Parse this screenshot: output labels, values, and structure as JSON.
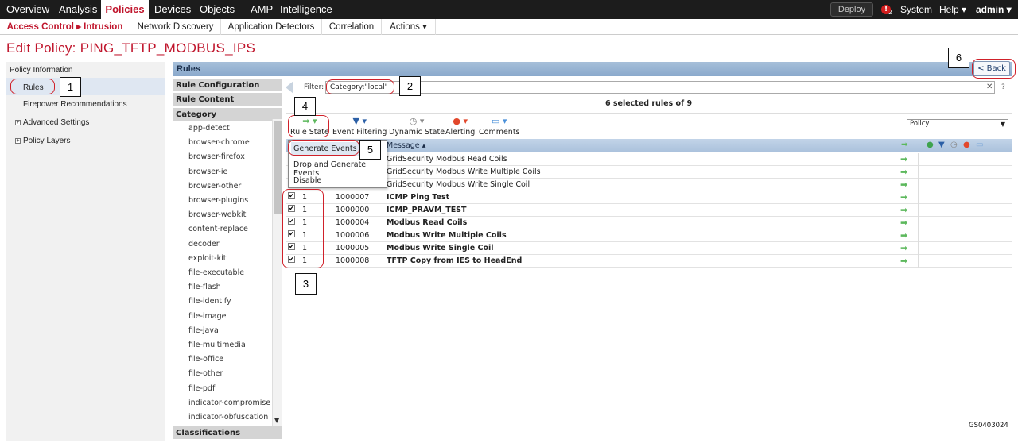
{
  "topnav": {
    "items": [
      "Overview",
      "Analysis",
      "Policies",
      "Devices",
      "Objects",
      "AMP",
      "Intelligence"
    ],
    "deploy": "Deploy",
    "alert_count": "2",
    "system": "System",
    "help": "Help ▾",
    "admin": "admin ▾"
  },
  "subnav": {
    "items": [
      "Access Control ▸ Intrusion",
      "Network Discovery",
      "Application Detectors",
      "Correlation",
      "Actions ▾"
    ]
  },
  "page": {
    "title": "Edit Policy: PING_TFTP_MODBUS_IPS"
  },
  "left": {
    "policy_info": "Policy Information",
    "rules": "Rules",
    "firepower": "Firepower Recommendations",
    "advanced": "Advanced Settings",
    "layers": "Policy Layers"
  },
  "rules_header": "Rules",
  "back_label": "< Back",
  "middle": {
    "rule_config": "Rule Configuration",
    "rule_content": "Rule Content",
    "category": "Category",
    "classifications": "Classifications",
    "categories": [
      "app-detect",
      "browser-chrome",
      "browser-firefox",
      "browser-ie",
      "browser-other",
      "browser-plugins",
      "browser-webkit",
      "content-replace",
      "decoder",
      "exploit-kit",
      "file-executable",
      "file-flash",
      "file-identify",
      "file-image",
      "file-java",
      "file-multimedia",
      "file-office",
      "file-other",
      "file-pdf",
      "indicator-compromise",
      "indicator-obfuscation"
    ]
  },
  "filter": {
    "label": "Filter:",
    "value": "Category:\"local\""
  },
  "selected_text": "6 selected rules of 9",
  "toolbar": {
    "rule_state": "Rule State",
    "event_filtering": "Event Filtering",
    "dynamic_state": "Dynamic State",
    "alerting": "Alerting",
    "comments": "Comments",
    "policy_select": "Policy"
  },
  "table": {
    "message_header": "Message ▴",
    "rows": [
      {
        "gid": "",
        "sid": "",
        "message": "GridSecurity Modbus Read Coils",
        "bold": false
      },
      {
        "gid": "",
        "sid": "",
        "message": "GridSecurity Modbus Write Multiple Coils",
        "bold": false
      },
      {
        "gid": "",
        "sid": "",
        "message": "GridSecurity Modbus Write Single Coil",
        "bold": false
      },
      {
        "gid": "1",
        "sid": "1000007",
        "message": "ICMP Ping Test",
        "bold": true
      },
      {
        "gid": "1",
        "sid": "1000000",
        "message": "ICMP_PRAVM_TEST",
        "bold": true
      },
      {
        "gid": "1",
        "sid": "1000004",
        "message": "Modbus Read Coils",
        "bold": true
      },
      {
        "gid": "1",
        "sid": "1000006",
        "message": "Modbus Write Multiple Coils",
        "bold": true
      },
      {
        "gid": "1",
        "sid": "1000005",
        "message": "Modbus Write Single Coil",
        "bold": true
      },
      {
        "gid": "1",
        "sid": "1000008",
        "message": "TFTP Copy from IES to HeadEnd",
        "bold": true
      }
    ]
  },
  "dropdown": {
    "items": [
      "Generate Events",
      "Drop and Generate Events",
      "Disable"
    ]
  },
  "callouts": [
    "1",
    "2",
    "3",
    "4",
    "5",
    "6"
  ],
  "doc_id": "GS0403024"
}
